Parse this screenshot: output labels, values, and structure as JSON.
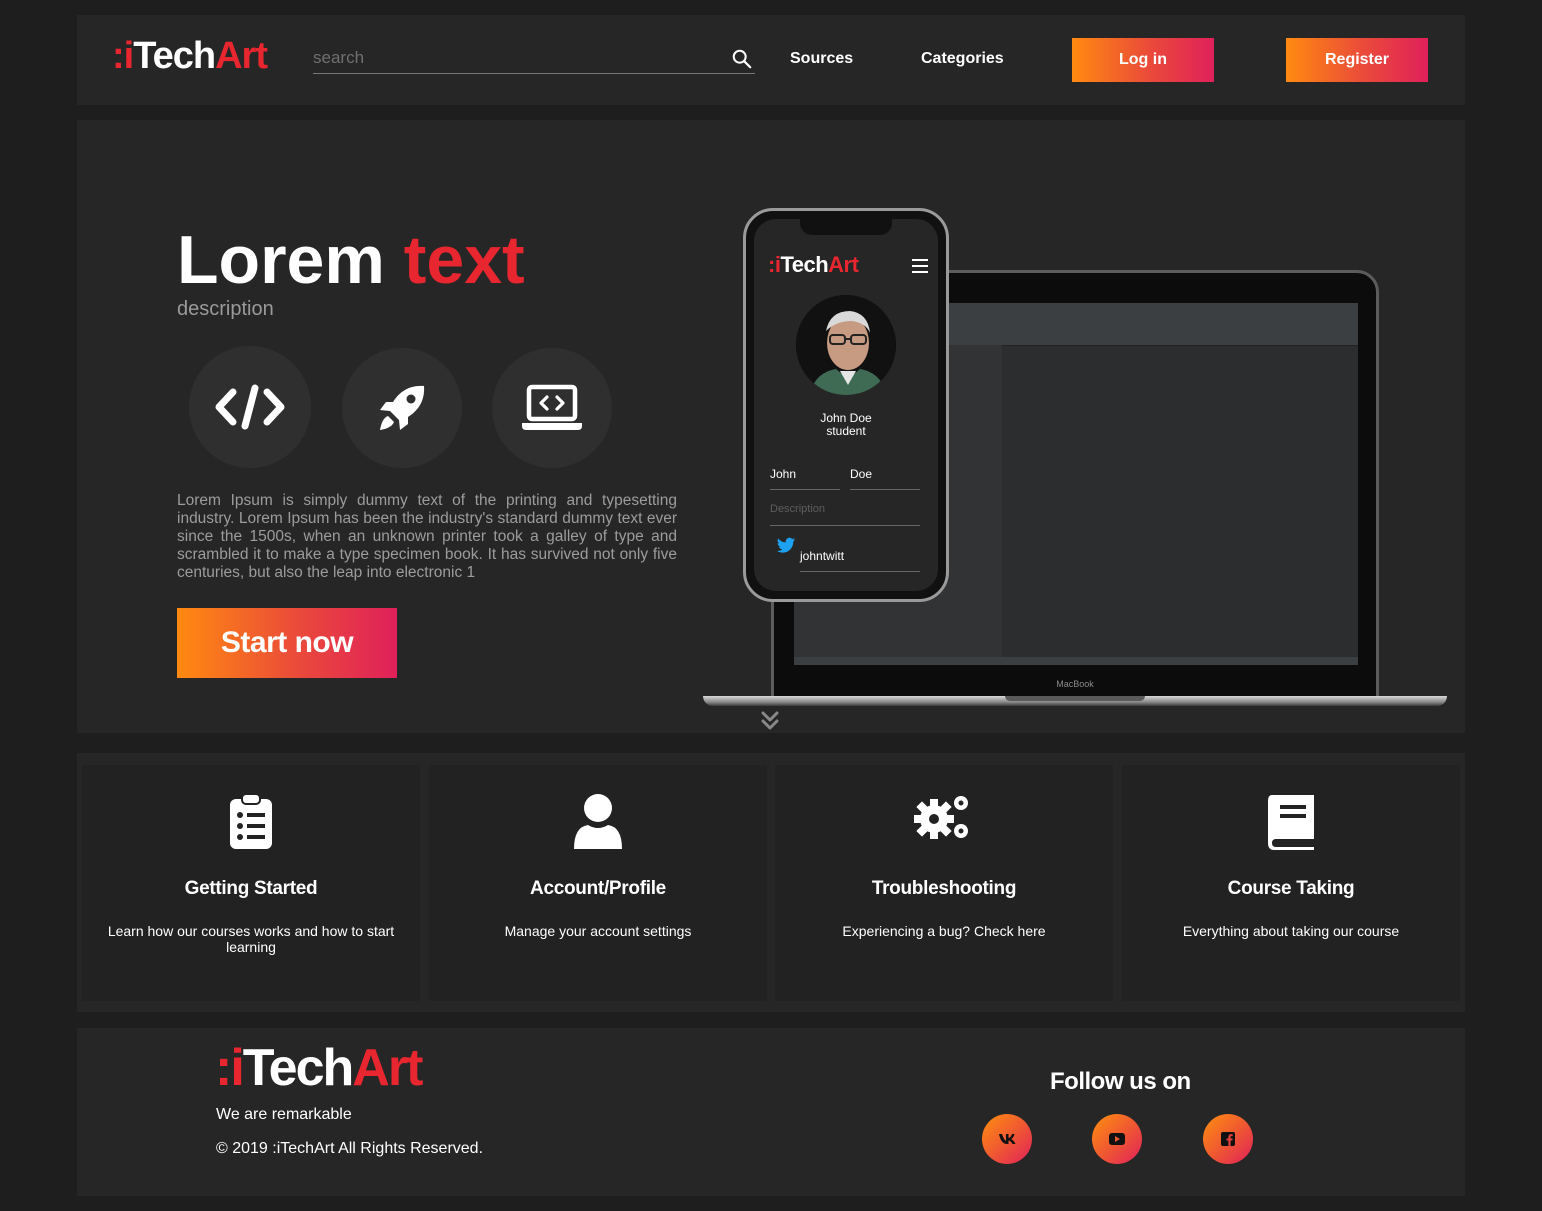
{
  "header": {
    "logo": {
      "dots": ":i",
      "tech": "Tech",
      "art": "Art"
    },
    "search_placeholder": "search",
    "nav": {
      "sources": "Sources",
      "categories": "Categories"
    },
    "login_label": "Log in",
    "register_label": "Register"
  },
  "hero": {
    "title_main": "Lorem",
    "title_highlight": "text",
    "subtitle": "description",
    "icons": [
      "code-icon",
      "rocket-icon",
      "laptop-code-icon"
    ],
    "paragraph": "Lorem Ipsum is simply dummy text of the printing and typesetting industry. Lorem Ipsum has been the industry's standard dummy text ever since the 1500s, when an unknown printer took a galley of type and scrambled it to make a type specimen book. It has survived not only five centuries, but also the leap into electronic 1",
    "cta_label": "Start now",
    "scroll_icon": "double-chevron-down-icon"
  },
  "mockup": {
    "phone": {
      "logo": {
        "dots": ":i",
        "tech": "Tech",
        "art": "Art"
      },
      "name": "John Doe",
      "role": "student",
      "first_name": "John",
      "last_name": "Doe",
      "description_placeholder": "Description",
      "twitter": "johntwitt"
    },
    "laptop_label": "MacBook"
  },
  "categories": [
    {
      "icon": "clipboard-list-icon",
      "title": "Getting Started",
      "desc": "Learn how our courses works and how to start learning"
    },
    {
      "icon": "user-icon",
      "title": "Account/Profile",
      "desc": "Manage your account settings"
    },
    {
      "icon": "cogs-icon",
      "title": "Troubleshooting",
      "desc": "Experiencing a bug? Check here"
    },
    {
      "icon": "book-icon",
      "title": "Course Taking",
      "desc": "Everything about taking our course"
    }
  ],
  "footer": {
    "logo": {
      "dots": ":i",
      "tech": "Tech",
      "art": "Art"
    },
    "tagline": "We are remarkable",
    "copyright": "© 2019 :iTechArt All Rights Reserved.",
    "follow_label": "Follow us on",
    "social": [
      "vk-icon",
      "youtube-icon",
      "facebook-icon"
    ]
  },
  "colors": {
    "background": "#1e1e1e",
    "panel": "#262626",
    "accent_red": "#e8262f",
    "gradient_start": "#ff8a10",
    "gradient_end": "#e0205a"
  }
}
